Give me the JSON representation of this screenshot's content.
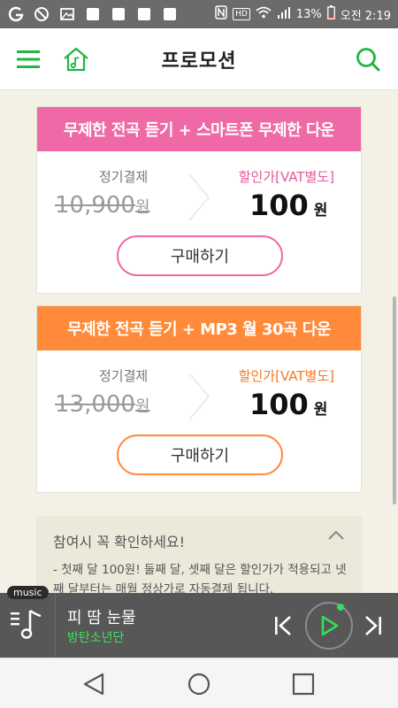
{
  "status_bar": {
    "hd": "HD",
    "battery": "13%",
    "time": "오전 2:19"
  },
  "header": {
    "title": "프로모션"
  },
  "promos": [
    {
      "title": "무제한 전곡 듣기 + 스마트폰 무제한 다운",
      "regular_label": "정기결제",
      "regular_price": "10,900",
      "currency": "원",
      "discount_label": "할인가[VAT별도]",
      "sale_price": "100",
      "buy_label": "구매하기",
      "color": "#ef69a6"
    },
    {
      "title": "무제한 전곡 듣기 + MP3 월 30곡 다운",
      "regular_label": "정기결제",
      "regular_price": "13,000",
      "currency": "원",
      "discount_label": "할인가[VAT별도]",
      "sale_price": "100",
      "buy_label": "구매하기",
      "color": "#ff8a3a"
    }
  ],
  "notice": {
    "title": "참여시 꼭 확인하세요!",
    "body": "- 첫째 달 100원! 둘째 달, 셋째 달은 할인가가 적용되고 넷째 달부터는 매월 정상가로 자동결제 됩니다."
  },
  "player": {
    "tag": "music",
    "song": "피 땀 눈물",
    "artist": "방탄소년단"
  }
}
